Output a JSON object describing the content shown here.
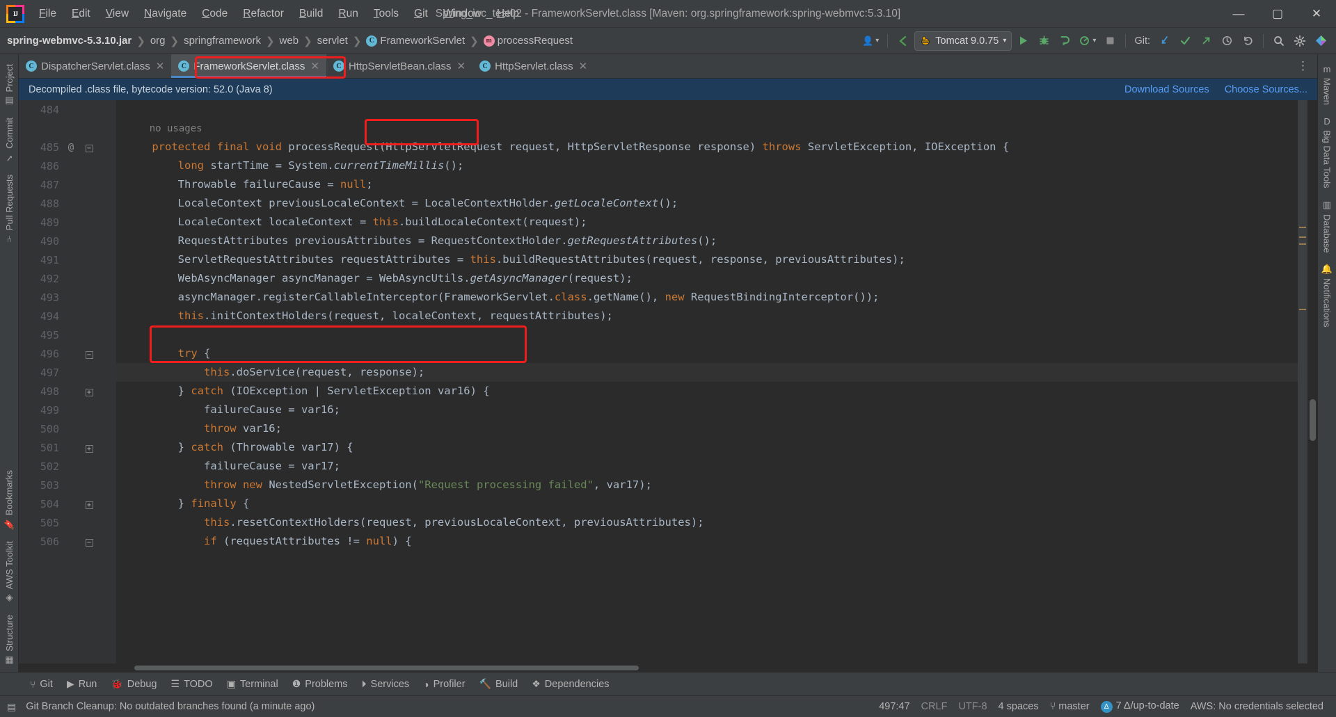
{
  "window": {
    "title": "Spring_ioc_test02 - FrameworkServlet.class [Maven: org.springframework:spring-webmvc:5.3.10]",
    "minimize": "—",
    "maximize": "▢",
    "close": "✕"
  },
  "menu": {
    "items": [
      {
        "pre": "",
        "u": "F",
        "post": "ile"
      },
      {
        "pre": "",
        "u": "E",
        "post": "dit"
      },
      {
        "pre": "",
        "u": "V",
        "post": "iew"
      },
      {
        "pre": "",
        "u": "N",
        "post": "avigate"
      },
      {
        "pre": "",
        "u": "C",
        "post": "ode"
      },
      {
        "pre": "",
        "u": "R",
        "post": "efactor"
      },
      {
        "pre": "",
        "u": "B",
        "post": "uild"
      },
      {
        "pre": "",
        "u": "R",
        "post": "un"
      },
      {
        "pre": "",
        "u": "T",
        "post": "ools"
      },
      {
        "pre": "",
        "u": "G",
        "post": "it"
      },
      {
        "pre": "",
        "u": "W",
        "post": "indow"
      },
      {
        "pre": "",
        "u": "H",
        "post": "elp"
      }
    ]
  },
  "breadcrumbs": [
    {
      "label": "spring-webmvc-5.3.10.jar",
      "icon": "",
      "bold": true
    },
    {
      "label": "org",
      "icon": ""
    },
    {
      "label": "springframework",
      "icon": ""
    },
    {
      "label": "web",
      "icon": ""
    },
    {
      "label": "servlet",
      "icon": ""
    },
    {
      "label": "FrameworkServlet",
      "icon": "class-icon",
      "glyph": "C"
    },
    {
      "label": "processRequest",
      "icon": "method-icon",
      "glyph": "m"
    }
  ],
  "toolbar": {
    "run_config": "Tomcat 9.0.75",
    "run_config_icon": "tomcat-icon",
    "dropdown_caret": "▾",
    "user_icon": "👤",
    "back_icon": "‹",
    "run_icon": "▶",
    "debug_icon": "🐞",
    "run_coverage_icon": "▣",
    "profile_icon": "◔",
    "stop_icon": "■",
    "git_label": "Git:",
    "git_update_icon": "↙",
    "git_commit_icon": "✓",
    "git_push_icon": "↗",
    "git_history_icon": "◷",
    "git_rollback_icon": "↺",
    "search_icon": "🔍",
    "settings_icon": "⚙",
    "profile_avatar_icon": "◆"
  },
  "tabs": [
    {
      "label": "DispatcherServlet.class",
      "active": false,
      "icon": "C",
      "close": "✕"
    },
    {
      "label": "FrameworkServlet.class",
      "active": true,
      "icon": "C",
      "close": "✕"
    },
    {
      "label": "HttpServletBean.class",
      "active": false,
      "icon": "C",
      "close": "✕"
    },
    {
      "label": "HttpServlet.class",
      "active": false,
      "icon": "C",
      "close": "✕"
    }
  ],
  "tab_overflow_icon": "⋮",
  "banner": {
    "message": "Decompiled .class file, bytecode version: 52.0 (Java 8)",
    "download_sources": "Download Sources",
    "choose_sources": "Choose Sources..."
  },
  "editor": {
    "first_line_number": 484,
    "current_line": 497,
    "lines": [
      {
        "n": 484,
        "ann": "",
        "fold": "",
        "tokens": []
      },
      {
        "n": null,
        "ann": "",
        "fold": "",
        "usage": "no usages",
        "indent": 4
      },
      {
        "n": 485,
        "ann": "@",
        "fold": "minus",
        "tokens": [
          {
            "t": "    ",
            "c": "id"
          },
          {
            "t": "protected final void ",
            "c": "kw"
          },
          {
            "t": "processRequest",
            "c": "id"
          },
          {
            "t": "(HttpServletRequest request, HttpServletResponse response) ",
            "c": "id"
          },
          {
            "t": "throws ",
            "c": "kw"
          },
          {
            "t": "ServletException, IOException {",
            "c": "id"
          }
        ]
      },
      {
        "n": 486,
        "ann": "",
        "fold": "",
        "tokens": [
          {
            "t": "        ",
            "c": "id"
          },
          {
            "t": "long ",
            "c": "kw"
          },
          {
            "t": "startTime = System.",
            "c": "id"
          },
          {
            "t": "currentTimeMillis",
            "c": "it"
          },
          {
            "t": "();",
            "c": "id"
          }
        ]
      },
      {
        "n": 487,
        "ann": "",
        "fold": "",
        "tokens": [
          {
            "t": "        Throwable failureCause = ",
            "c": "id"
          },
          {
            "t": "null",
            "c": "kw"
          },
          {
            "t": ";",
            "c": "id"
          }
        ]
      },
      {
        "n": 488,
        "ann": "",
        "fold": "",
        "tokens": [
          {
            "t": "        LocaleContext previousLocaleContext = LocaleContextHolder.",
            "c": "id"
          },
          {
            "t": "getLocaleContext",
            "c": "it"
          },
          {
            "t": "();",
            "c": "id"
          }
        ]
      },
      {
        "n": 489,
        "ann": "",
        "fold": "",
        "tokens": [
          {
            "t": "        LocaleContext localeContext = ",
            "c": "id"
          },
          {
            "t": "this",
            "c": "kw"
          },
          {
            "t": ".buildLocaleContext(request);",
            "c": "id"
          }
        ]
      },
      {
        "n": 490,
        "ann": "",
        "fold": "",
        "tokens": [
          {
            "t": "        RequestAttributes previousAttributes = RequestContextHolder.",
            "c": "id"
          },
          {
            "t": "getRequestAttributes",
            "c": "it"
          },
          {
            "t": "();",
            "c": "id"
          }
        ]
      },
      {
        "n": 491,
        "ann": "",
        "fold": "",
        "tokens": [
          {
            "t": "        ServletRequestAttributes requestAttributes = ",
            "c": "id"
          },
          {
            "t": "this",
            "c": "kw"
          },
          {
            "t": ".buildRequestAttributes(request, response, previousAttributes);",
            "c": "id"
          }
        ]
      },
      {
        "n": 492,
        "ann": "",
        "fold": "",
        "tokens": [
          {
            "t": "        WebAsyncManager asyncManager = WebAsyncUtils.",
            "c": "id"
          },
          {
            "t": "getAsyncManager",
            "c": "it"
          },
          {
            "t": "(request);",
            "c": "id"
          }
        ]
      },
      {
        "n": 493,
        "ann": "",
        "fold": "",
        "tokens": [
          {
            "t": "        asyncManager.registerCallableInterceptor(FrameworkServlet.",
            "c": "id"
          },
          {
            "t": "class",
            "c": "kw"
          },
          {
            "t": ".getName(), ",
            "c": "id"
          },
          {
            "t": "new ",
            "c": "kw"
          },
          {
            "t": "RequestBindingInterceptor());",
            "c": "id"
          }
        ]
      },
      {
        "n": 494,
        "ann": "",
        "fold": "",
        "tokens": [
          {
            "t": "        ",
            "c": "id"
          },
          {
            "t": "this",
            "c": "kw"
          },
          {
            "t": ".initContextHolders(request, localeContext, requestAttributes);",
            "c": "id"
          }
        ]
      },
      {
        "n": 495,
        "ann": "",
        "fold": "",
        "tokens": []
      },
      {
        "n": 496,
        "ann": "",
        "fold": "minus",
        "tokens": [
          {
            "t": "        ",
            "c": "id"
          },
          {
            "t": "try ",
            "c": "kw"
          },
          {
            "t": "{",
            "c": "id"
          }
        ]
      },
      {
        "n": 497,
        "ann": "",
        "fold": "",
        "current": true,
        "tokens": [
          {
            "t": "            ",
            "c": "id"
          },
          {
            "t": "this",
            "c": "kw"
          },
          {
            "t": ".doService(request, response);",
            "c": "id"
          }
        ]
      },
      {
        "n": 498,
        "ann": "",
        "fold": "plus",
        "tokens": [
          {
            "t": "        } ",
            "c": "id"
          },
          {
            "t": "catch ",
            "c": "kw"
          },
          {
            "t": "(IOException | ServletException var16) {",
            "c": "id"
          }
        ]
      },
      {
        "n": 499,
        "ann": "",
        "fold": "",
        "tokens": [
          {
            "t": "            failureCause = var16;",
            "c": "id"
          }
        ]
      },
      {
        "n": 500,
        "ann": "",
        "fold": "",
        "tokens": [
          {
            "t": "            ",
            "c": "id"
          },
          {
            "t": "throw ",
            "c": "kw"
          },
          {
            "t": "var16;",
            "c": "id"
          }
        ]
      },
      {
        "n": 501,
        "ann": "",
        "fold": "plus",
        "tokens": [
          {
            "t": "        } ",
            "c": "id"
          },
          {
            "t": "catch ",
            "c": "kw"
          },
          {
            "t": "(Throwable var17) {",
            "c": "id"
          }
        ]
      },
      {
        "n": 502,
        "ann": "",
        "fold": "",
        "tokens": [
          {
            "t": "            failureCause = var17;",
            "c": "id"
          }
        ]
      },
      {
        "n": 503,
        "ann": "",
        "fold": "",
        "tokens": [
          {
            "t": "            ",
            "c": "id"
          },
          {
            "t": "throw new ",
            "c": "kw"
          },
          {
            "t": "NestedServletException(",
            "c": "id"
          },
          {
            "t": "\"Request processing failed\"",
            "c": "st"
          },
          {
            "t": ", var17);",
            "c": "id"
          }
        ]
      },
      {
        "n": 504,
        "ann": "",
        "fold": "plus",
        "tokens": [
          {
            "t": "        } ",
            "c": "id"
          },
          {
            "t": "finally ",
            "c": "kw"
          },
          {
            "t": "{",
            "c": "id"
          }
        ]
      },
      {
        "n": 505,
        "ann": "",
        "fold": "",
        "tokens": [
          {
            "t": "            ",
            "c": "id"
          },
          {
            "t": "this",
            "c": "kw"
          },
          {
            "t": ".resetContextHolders(request, previousLocaleContext, previousAttributes);",
            "c": "id"
          }
        ]
      },
      {
        "n": 506,
        "ann": "",
        "fold": "minus",
        "tokens": [
          {
            "t": "            ",
            "c": "id"
          },
          {
            "t": "if ",
            "c": "kw"
          },
          {
            "t": "(requestAttributes != ",
            "c": "id"
          },
          {
            "t": "null",
            "c": "kw"
          },
          {
            "t": ") {",
            "c": "id"
          }
        ]
      }
    ]
  },
  "left_strip": {
    "items": [
      {
        "label": "Project",
        "icon": "project-icon",
        "glyph": "▤"
      },
      {
        "label": "Commit",
        "icon": "commit-icon",
        "glyph": "✓"
      },
      {
        "label": "Pull Requests",
        "icon": "pull-requests-icon",
        "glyph": "⑂"
      },
      {
        "label": "Bookmarks",
        "icon": "bookmarks-icon",
        "glyph": "🔖"
      },
      {
        "label": "AWS Toolkit",
        "icon": "aws-icon",
        "glyph": "◈"
      },
      {
        "label": "Structure",
        "icon": "structure-icon",
        "glyph": "▦"
      }
    ]
  },
  "right_strip": {
    "items": [
      {
        "label": "Maven",
        "icon": "maven-icon",
        "glyph": "m"
      },
      {
        "label": "Big Data Tools",
        "icon": "big-data-tools-icon",
        "glyph": "D"
      },
      {
        "label": "Database",
        "icon": "database-icon",
        "glyph": "▥"
      },
      {
        "label": "Notifications",
        "icon": "notifications-icon",
        "glyph": "🔔"
      }
    ]
  },
  "bottom_bar": {
    "items": [
      {
        "label": "Git",
        "icon": "git-icon",
        "glyph": "⑂"
      },
      {
        "label": "Run",
        "icon": "run-icon",
        "glyph": "▶"
      },
      {
        "label": "Debug",
        "icon": "debug-icon",
        "glyph": "🐞"
      },
      {
        "label": "TODO",
        "icon": "todo-icon",
        "glyph": "☰"
      },
      {
        "label": "Terminal",
        "icon": "terminal-icon",
        "glyph": "▣"
      },
      {
        "label": "Problems",
        "icon": "problems-icon",
        "glyph": "❶"
      },
      {
        "label": "Services",
        "icon": "services-icon",
        "glyph": "⏵"
      },
      {
        "label": "Profiler",
        "icon": "profiler-icon",
        "glyph": "◑"
      },
      {
        "label": "Build",
        "icon": "build-icon",
        "glyph": "🔨"
      },
      {
        "label": "Dependencies",
        "icon": "dependencies-icon",
        "glyph": "❖"
      }
    ]
  },
  "status_bar": {
    "message": "Git Branch Cleanup: No outdated branches found (a minute ago)",
    "message_icon": "book-icon",
    "caret_position": "497:47",
    "line_separator": "CRLF",
    "encoding": "UTF-8",
    "indent": "4 spaces",
    "branch": "master",
    "branch_icon": "branch-icon",
    "vcs_status": "7 Δ/up-to-date",
    "vcs_badge": "Δ",
    "aws": "AWS: No credentials selected"
  },
  "colors": {
    "accent_blue": "#4a88c7",
    "annotation_red": "#f01d1d",
    "banner_blue": "#1e3c5a",
    "editor_bg": "#2b2b2b",
    "chrome_bg": "#3c3f41",
    "keyword_orange": "#cc7832",
    "string_green": "#6a8759",
    "identifier_gray": "#a9b7c6"
  }
}
